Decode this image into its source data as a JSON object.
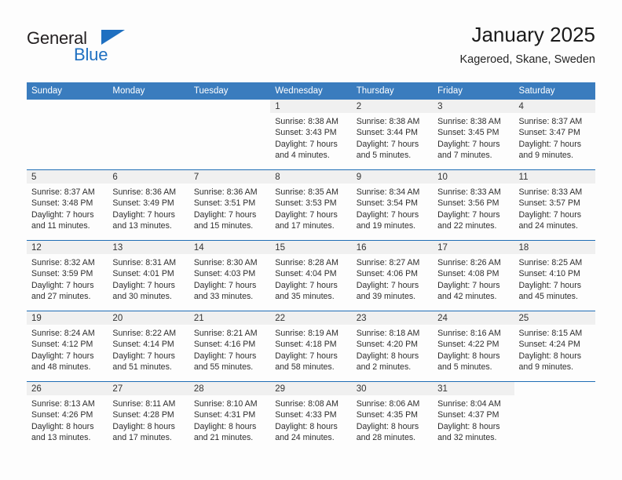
{
  "brand": {
    "name_part1": "General",
    "name_part2": "Blue",
    "triangle_color": "#1f70c1"
  },
  "header": {
    "title": "January 2025",
    "subtitle": "Kageroed, Skane, Sweden"
  },
  "theme": {
    "header_blue": "#3a7cbe",
    "row_rule_blue": "#1f6db5",
    "daynum_band": "#f0f0f0",
    "page_background": "#fdfdfd"
  },
  "calendar": {
    "weekday_headers": [
      "Sunday",
      "Monday",
      "Tuesday",
      "Wednesday",
      "Thursday",
      "Friday",
      "Saturday"
    ],
    "labels": {
      "sunrise": "Sunrise:",
      "sunset": "Sunset:",
      "daylight": "Daylight:"
    },
    "weeks": [
      [
        {
          "day": "",
          "blank": true
        },
        {
          "day": "",
          "blank": true
        },
        {
          "day": "",
          "blank": true
        },
        {
          "day": "1",
          "sunrise": "Sunrise: 8:38 AM",
          "sunset": "Sunset: 3:43 PM",
          "daylight1": "Daylight: 7 hours",
          "daylight2": "and 4 minutes."
        },
        {
          "day": "2",
          "sunrise": "Sunrise: 8:38 AM",
          "sunset": "Sunset: 3:44 PM",
          "daylight1": "Daylight: 7 hours",
          "daylight2": "and 5 minutes."
        },
        {
          "day": "3",
          "sunrise": "Sunrise: 8:38 AM",
          "sunset": "Sunset: 3:45 PM",
          "daylight1": "Daylight: 7 hours",
          "daylight2": "and 7 minutes."
        },
        {
          "day": "4",
          "sunrise": "Sunrise: 8:37 AM",
          "sunset": "Sunset: 3:47 PM",
          "daylight1": "Daylight: 7 hours",
          "daylight2": "and 9 minutes."
        }
      ],
      [
        {
          "day": "5",
          "sunrise": "Sunrise: 8:37 AM",
          "sunset": "Sunset: 3:48 PM",
          "daylight1": "Daylight: 7 hours",
          "daylight2": "and 11 minutes."
        },
        {
          "day": "6",
          "sunrise": "Sunrise: 8:36 AM",
          "sunset": "Sunset: 3:49 PM",
          "daylight1": "Daylight: 7 hours",
          "daylight2": "and 13 minutes."
        },
        {
          "day": "7",
          "sunrise": "Sunrise: 8:36 AM",
          "sunset": "Sunset: 3:51 PM",
          "daylight1": "Daylight: 7 hours",
          "daylight2": "and 15 minutes."
        },
        {
          "day": "8",
          "sunrise": "Sunrise: 8:35 AM",
          "sunset": "Sunset: 3:53 PM",
          "daylight1": "Daylight: 7 hours",
          "daylight2": "and 17 minutes."
        },
        {
          "day": "9",
          "sunrise": "Sunrise: 8:34 AM",
          "sunset": "Sunset: 3:54 PM",
          "daylight1": "Daylight: 7 hours",
          "daylight2": "and 19 minutes."
        },
        {
          "day": "10",
          "sunrise": "Sunrise: 8:33 AM",
          "sunset": "Sunset: 3:56 PM",
          "daylight1": "Daylight: 7 hours",
          "daylight2": "and 22 minutes."
        },
        {
          "day": "11",
          "sunrise": "Sunrise: 8:33 AM",
          "sunset": "Sunset: 3:57 PM",
          "daylight1": "Daylight: 7 hours",
          "daylight2": "and 24 minutes."
        }
      ],
      [
        {
          "day": "12",
          "sunrise": "Sunrise: 8:32 AM",
          "sunset": "Sunset: 3:59 PM",
          "daylight1": "Daylight: 7 hours",
          "daylight2": "and 27 minutes."
        },
        {
          "day": "13",
          "sunrise": "Sunrise: 8:31 AM",
          "sunset": "Sunset: 4:01 PM",
          "daylight1": "Daylight: 7 hours",
          "daylight2": "and 30 minutes."
        },
        {
          "day": "14",
          "sunrise": "Sunrise: 8:30 AM",
          "sunset": "Sunset: 4:03 PM",
          "daylight1": "Daylight: 7 hours",
          "daylight2": "and 33 minutes."
        },
        {
          "day": "15",
          "sunrise": "Sunrise: 8:28 AM",
          "sunset": "Sunset: 4:04 PM",
          "daylight1": "Daylight: 7 hours",
          "daylight2": "and 35 minutes."
        },
        {
          "day": "16",
          "sunrise": "Sunrise: 8:27 AM",
          "sunset": "Sunset: 4:06 PM",
          "daylight1": "Daylight: 7 hours",
          "daylight2": "and 39 minutes."
        },
        {
          "day": "17",
          "sunrise": "Sunrise: 8:26 AM",
          "sunset": "Sunset: 4:08 PM",
          "daylight1": "Daylight: 7 hours",
          "daylight2": "and 42 minutes."
        },
        {
          "day": "18",
          "sunrise": "Sunrise: 8:25 AM",
          "sunset": "Sunset: 4:10 PM",
          "daylight1": "Daylight: 7 hours",
          "daylight2": "and 45 minutes."
        }
      ],
      [
        {
          "day": "19",
          "sunrise": "Sunrise: 8:24 AM",
          "sunset": "Sunset: 4:12 PM",
          "daylight1": "Daylight: 7 hours",
          "daylight2": "and 48 minutes."
        },
        {
          "day": "20",
          "sunrise": "Sunrise: 8:22 AM",
          "sunset": "Sunset: 4:14 PM",
          "daylight1": "Daylight: 7 hours",
          "daylight2": "and 51 minutes."
        },
        {
          "day": "21",
          "sunrise": "Sunrise: 8:21 AM",
          "sunset": "Sunset: 4:16 PM",
          "daylight1": "Daylight: 7 hours",
          "daylight2": "and 55 minutes."
        },
        {
          "day": "22",
          "sunrise": "Sunrise: 8:19 AM",
          "sunset": "Sunset: 4:18 PM",
          "daylight1": "Daylight: 7 hours",
          "daylight2": "and 58 minutes."
        },
        {
          "day": "23",
          "sunrise": "Sunrise: 8:18 AM",
          "sunset": "Sunset: 4:20 PM",
          "daylight1": "Daylight: 8 hours",
          "daylight2": "and 2 minutes."
        },
        {
          "day": "24",
          "sunrise": "Sunrise: 8:16 AM",
          "sunset": "Sunset: 4:22 PM",
          "daylight1": "Daylight: 8 hours",
          "daylight2": "and 5 minutes."
        },
        {
          "day": "25",
          "sunrise": "Sunrise: 8:15 AM",
          "sunset": "Sunset: 4:24 PM",
          "daylight1": "Daylight: 8 hours",
          "daylight2": "and 9 minutes."
        }
      ],
      [
        {
          "day": "26",
          "sunrise": "Sunrise: 8:13 AM",
          "sunset": "Sunset: 4:26 PM",
          "daylight1": "Daylight: 8 hours",
          "daylight2": "and 13 minutes."
        },
        {
          "day": "27",
          "sunrise": "Sunrise: 8:11 AM",
          "sunset": "Sunset: 4:28 PM",
          "daylight1": "Daylight: 8 hours",
          "daylight2": "and 17 minutes."
        },
        {
          "day": "28",
          "sunrise": "Sunrise: 8:10 AM",
          "sunset": "Sunset: 4:31 PM",
          "daylight1": "Daylight: 8 hours",
          "daylight2": "and 21 minutes."
        },
        {
          "day": "29",
          "sunrise": "Sunrise: 8:08 AM",
          "sunset": "Sunset: 4:33 PM",
          "daylight1": "Daylight: 8 hours",
          "daylight2": "and 24 minutes."
        },
        {
          "day": "30",
          "sunrise": "Sunrise: 8:06 AM",
          "sunset": "Sunset: 4:35 PM",
          "daylight1": "Daylight: 8 hours",
          "daylight2": "and 28 minutes."
        },
        {
          "day": "31",
          "sunrise": "Sunrise: 8:04 AM",
          "sunset": "Sunset: 4:37 PM",
          "daylight1": "Daylight: 8 hours",
          "daylight2": "and 32 minutes."
        },
        {
          "day": "",
          "blank": true
        }
      ]
    ]
  }
}
